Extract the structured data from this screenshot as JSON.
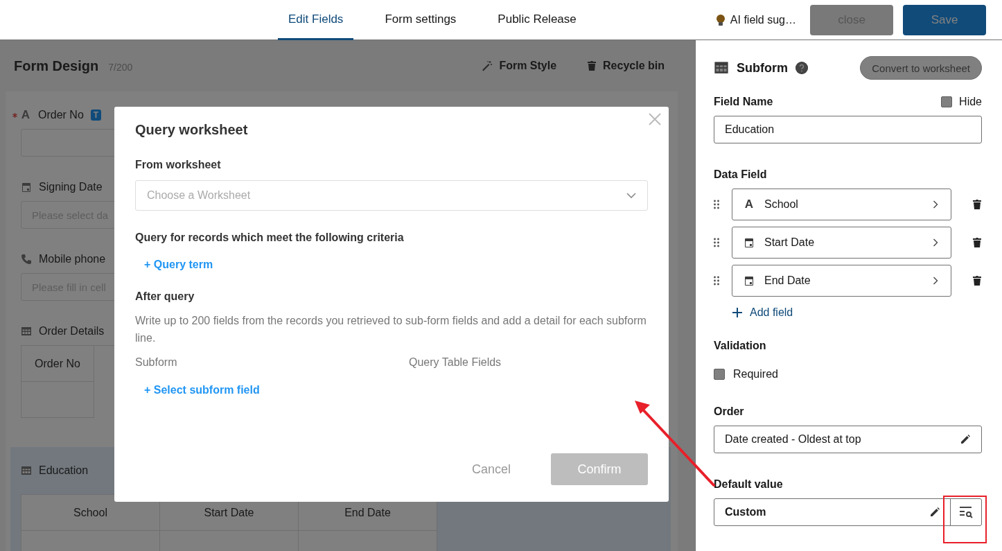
{
  "top_bar": {
    "tabs": [
      {
        "label": "Edit Fields",
        "selected": true
      },
      {
        "label": "Form settings",
        "selected": false
      },
      {
        "label": "Public Release",
        "selected": false
      }
    ],
    "ai_suggestion": "AI field sug…",
    "close_button": {
      "label": "close",
      "disabled": true
    },
    "save_button": "Save"
  },
  "form_design": {
    "title": "Form Design",
    "count": "7/200",
    "actions": [
      {
        "kind": "style",
        "label": "Form Style"
      },
      {
        "kind": "recycle",
        "label": "Recycle bin"
      }
    ],
    "fields": [
      {
        "kind": "text",
        "glyph": "A",
        "label": "Order No",
        "required": true,
        "badge": "T"
      },
      {
        "kind": "date",
        "label": "Signing Date",
        "required": false,
        "placeholder": "Please select da"
      },
      {
        "kind": "phone",
        "label": "Mobile phone",
        "required": false,
        "placeholder": "Please fill in cell"
      },
      {
        "kind": "subform",
        "label": "Order Details",
        "required": false,
        "selected": false,
        "columns": [
          "Order No"
        ]
      },
      {
        "kind": "subform",
        "label": "Education",
        "required": false,
        "selected": true,
        "columns": [
          "School",
          "Start Date",
          "End Date"
        ]
      }
    ]
  },
  "properties": {
    "title": "Subform",
    "convert_button": "Convert to worksheet",
    "field_name_label": "Field Name",
    "hide": {
      "label": "Hide",
      "checked": false
    },
    "field_name_value": "Education",
    "data_field_label": "Data Field",
    "data_fields": [
      {
        "kind": "text",
        "glyph": "A",
        "label": "School"
      },
      {
        "kind": "date",
        "label": "Start Date"
      },
      {
        "kind": "date",
        "label": "End Date"
      }
    ],
    "add_field": "Add field",
    "validation_label": "Validation",
    "required": {
      "label": "Required",
      "checked": false
    },
    "order_label": "Order",
    "order_value": "Date created - Oldest at top",
    "default_label": "Default value",
    "default_value": "Custom"
  },
  "dialog": {
    "title": "Query worksheet",
    "from_label": "From worksheet",
    "worksheet_placeholder": "Choose a Worksheet",
    "criteria_label": "Query for records which meet the following criteria",
    "query_term_link": "+ Query term",
    "after_label": "After query",
    "description": "Write up to 200 fields from the records you retrieved to sub-form fields and add a detail for each subform line.",
    "columns": [
      "Subform",
      "Query Table Fields"
    ],
    "select_field_link": "+ Select subform field",
    "cancel_button": "Cancel",
    "confirm_button": {
      "label": "Confirm",
      "disabled": true
    }
  }
}
